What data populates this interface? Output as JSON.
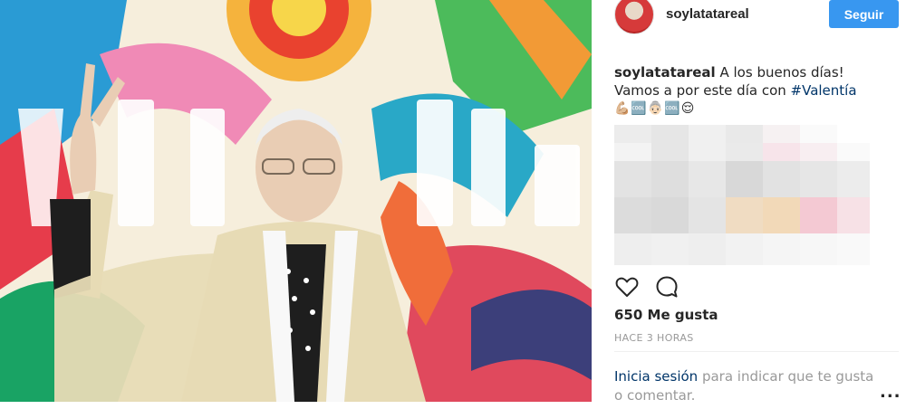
{
  "post": {
    "username": "soylatatareal",
    "follow_label": "Seguir",
    "caption": {
      "user": "soylatatareal",
      "text_line1": "A los buenos días!",
      "text_line2_prefix": "Vamos a por este día con ",
      "hashtag": "#Valentía",
      "emojis": "💪🏼🆒👵🏻🆒😌"
    },
    "likes": "650 Me gusta",
    "timestamp": "HACE 3 HORAS",
    "login_prompt": {
      "link": "Inicia sesión",
      "text": " para indicar que te gusta o comentar."
    },
    "more_label": "...",
    "icons": {
      "like": "heart-icon",
      "comment": "comment-bubble-icon",
      "options": "more-options-icon"
    }
  },
  "colors": {
    "follow_button": "#3897f0",
    "link": "#003569",
    "muted_text": "#999999",
    "text": "#262626"
  }
}
